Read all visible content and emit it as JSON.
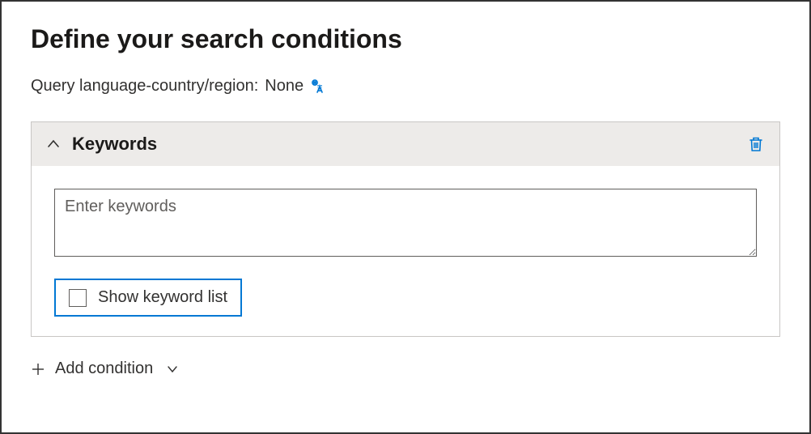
{
  "page": {
    "title": "Define your search conditions",
    "query_language_label": "Query language-country/region:",
    "query_language_value": "None"
  },
  "keywords_panel": {
    "title": "Keywords",
    "textarea_placeholder": "Enter keywords",
    "textarea_value": "",
    "show_list_label": "Show keyword list",
    "show_list_checked": false
  },
  "actions": {
    "add_condition_label": "Add condition"
  }
}
